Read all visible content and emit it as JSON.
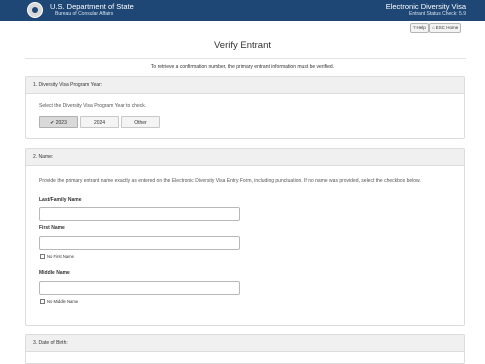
{
  "header": {
    "department": "U.S. Department of State",
    "bureau": "Bureau of Consular Affairs",
    "app_title": "Electronic Diversity Visa",
    "app_subtitle": "Entrant Status Check: 5.9"
  },
  "toolbar": {
    "help_label": "Help",
    "help_icon": "question-circle-icon",
    "home_label": "ESC Home",
    "home_icon": "home-icon"
  },
  "page": {
    "title": "Verify Entrant",
    "intro": "To retrieve a confirmation number, the primary entrant information must be verified."
  },
  "program_year": {
    "heading": "1. Diversity Visa Program Year:",
    "prompt": "Select the Diversity Visa Program Year to check.",
    "options": [
      "2023",
      "2024",
      "Other"
    ],
    "selected": "2023",
    "check_mark": "✔"
  },
  "name": {
    "heading": "2. Name:",
    "description": "Provide the primary entrant name exactly as entered on the Electronic Diversity Visa Entry Form, including punctuation. If no name was provided, select the checkbox below.",
    "last_label": "Last/Family Name",
    "last_value": "",
    "first_label": "First Name",
    "first_value": "",
    "no_first_label": "No First Name",
    "middle_label": "Middle Name",
    "middle_value": "",
    "no_middle_label": "No Middle Name"
  },
  "dob": {
    "heading": "3. Date of Birth:"
  },
  "colors": {
    "header_bg": "#1f4775",
    "panel_head_bg": "#f0f0f0"
  }
}
